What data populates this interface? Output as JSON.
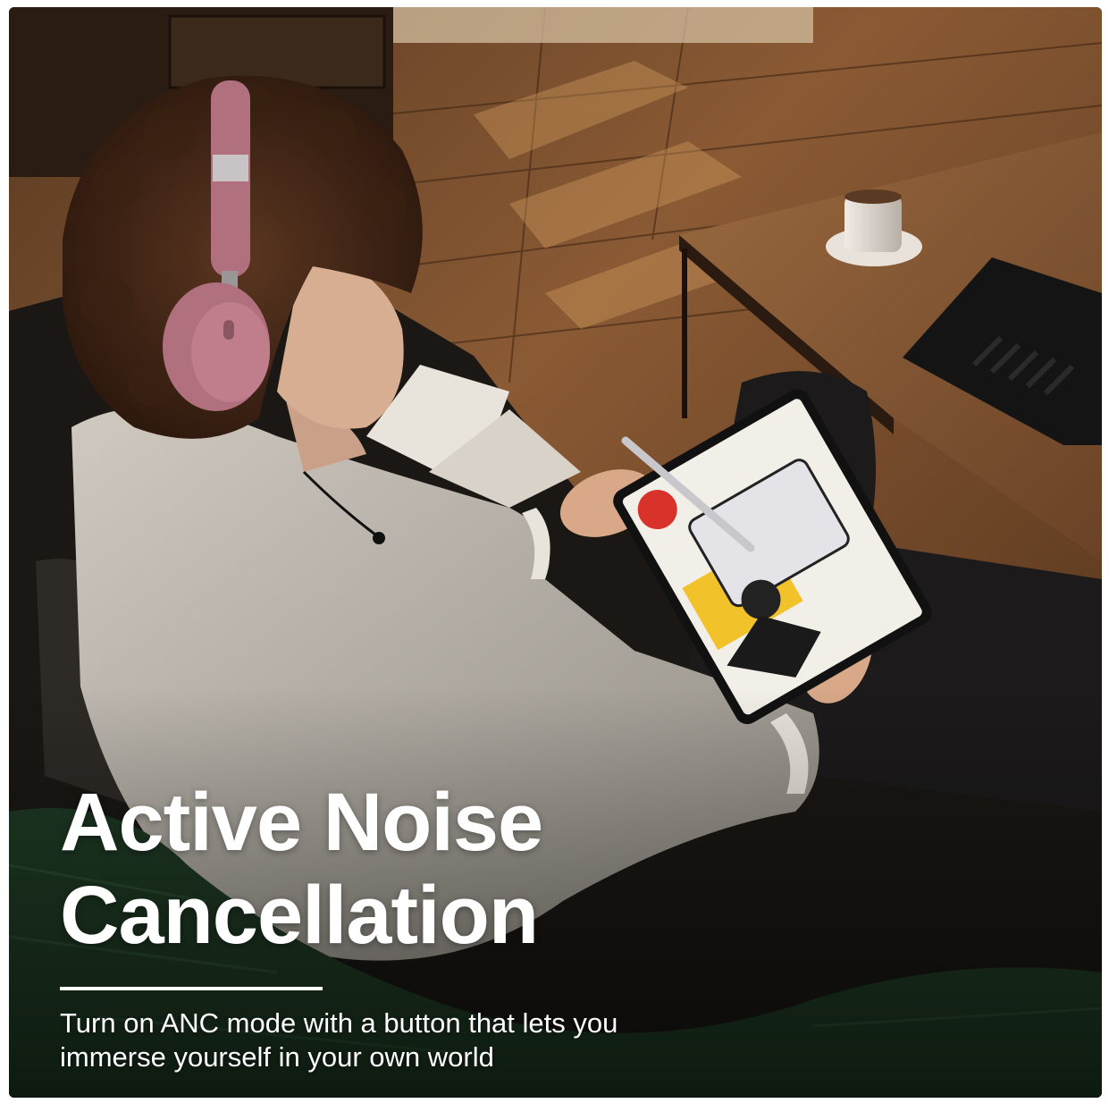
{
  "headline": {
    "line1": "Active Noise",
    "line2": "Cancellation"
  },
  "subheadline": {
    "line1": "Turn on ANC mode with a button that lets you",
    "line2": "immerse yourself in your own world"
  },
  "colors": {
    "text": "#ffffff",
    "headphones": "#b0707e",
    "floor": "#7a4a2a",
    "sweater": "#b8b2aa",
    "blanket": "#1f3a24",
    "sofa": "#181614"
  }
}
